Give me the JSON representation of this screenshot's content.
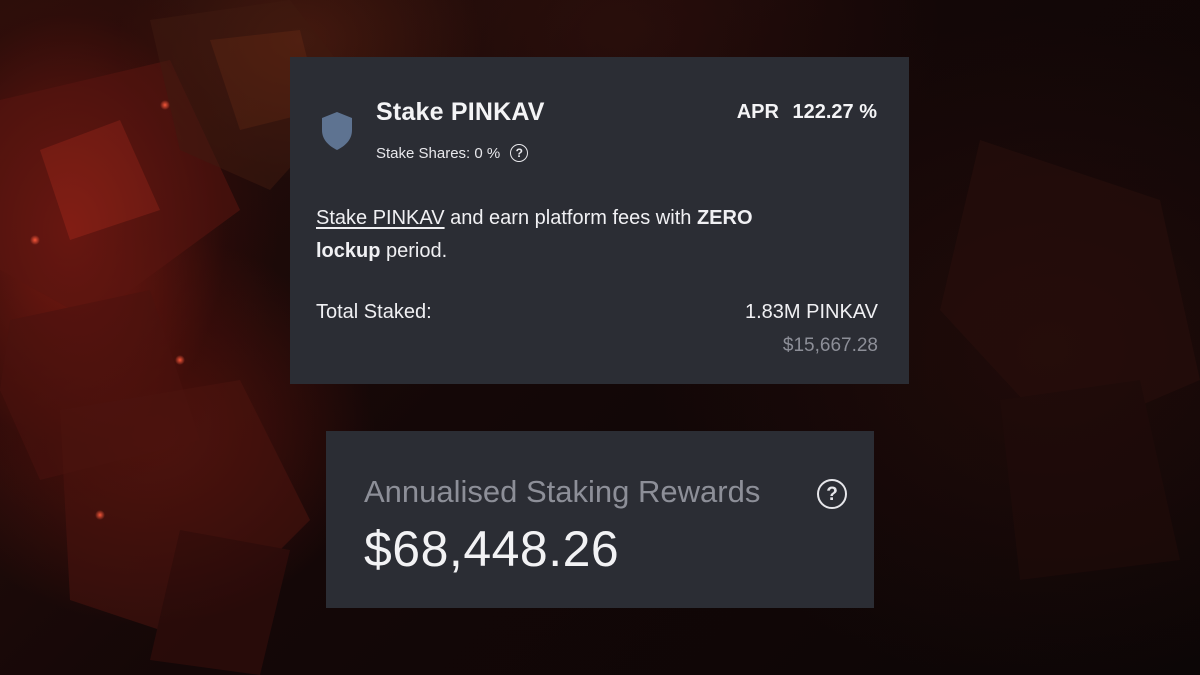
{
  "stake_card": {
    "title": "Stake PINKAV",
    "shares_label": "Stake Shares: 0 %",
    "apr_label": "APR",
    "apr_value": "122.27 %",
    "description": {
      "link_text": "Stake PINKAV",
      "text_1": " and earn platform fees with ",
      "bold_1": "ZERO",
      "bold_2": "lockup",
      "text_2": " period."
    },
    "total_label": "Total Staked:",
    "total_amount": "1.83M PINKAV",
    "total_usd": "$15,667.28"
  },
  "rewards_card": {
    "label": "Annualised Staking Rewards",
    "value": "$68,448.26"
  },
  "icons": {
    "shield": "shield-icon",
    "help": "question-circle-icon"
  },
  "colors": {
    "card_bg": "#2b2d34",
    "text_primary": "#f0f0f3",
    "text_muted": "#8d8f98",
    "shield": "#5e7391"
  }
}
